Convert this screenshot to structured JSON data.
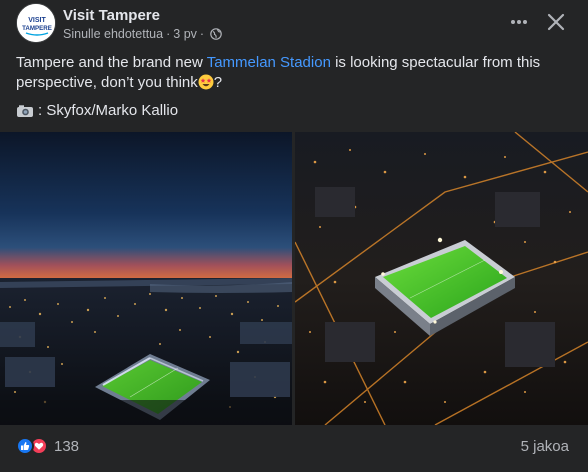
{
  "post": {
    "page_name": "Visit Tampere",
    "avatar_text": {
      "line1": "VISIT",
      "line2": "TAMPERE"
    },
    "suggested_label": "Sinulle ehdotettua",
    "separator": "·",
    "time": "3 pv",
    "privacy_icon": "globe-icon",
    "text_before_link": "Tampere and the brand new ",
    "link_text": "Tammelan Stadion",
    "text_after_link": " is looking spectacular from this perspective, don’t you think",
    "text_emoji": "star-struck-emoji",
    "text_end": "?",
    "credit_icon": "camera-icon",
    "credit_text": ": Skyfox/Marko Kallio"
  },
  "photos": [
    {
      "name": "aerial-dusk-city-stadium-photo"
    },
    {
      "name": "aerial-night-stadium-closeup-photo"
    }
  ],
  "footer": {
    "reaction_icons": [
      "like-icon",
      "love-icon"
    ],
    "reaction_count": "138",
    "shares": "5 jakoa"
  },
  "colors": {
    "background": "#242526",
    "text": "#e4e6eb",
    "secondary_text": "#b0b3b8",
    "link": "#4599ff",
    "like": "#1877f2",
    "love": "#f33e58"
  }
}
